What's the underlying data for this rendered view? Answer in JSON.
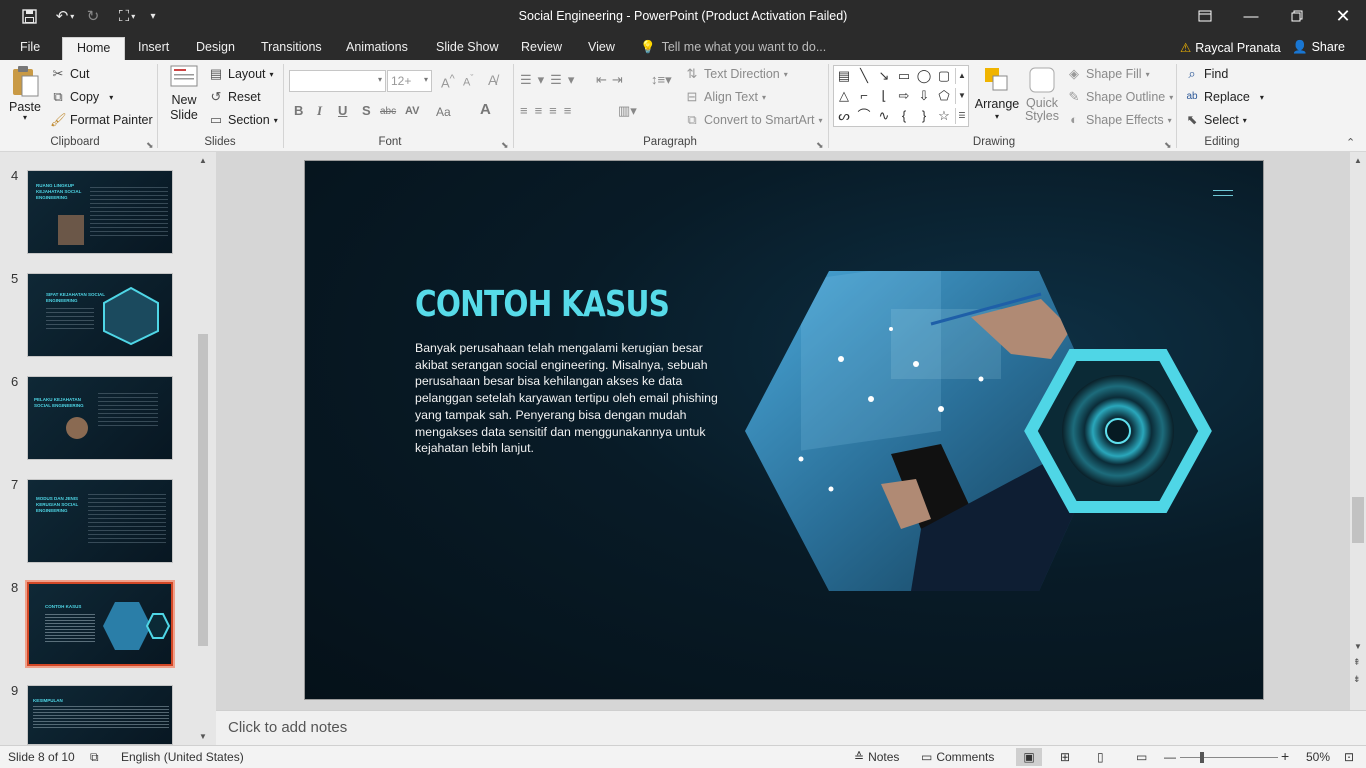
{
  "app": {
    "window_title": "Social Engineering - PowerPoint (Product Activation Failed)",
    "window_controls": {
      "ribbon_display_icon": "ribbon-display-icon",
      "minimize_icon": "minimize-icon",
      "restore_icon": "restore-icon",
      "close_icon": "close-icon"
    }
  },
  "qat": {
    "save_icon": "save-icon",
    "undo_icon": "undo-icon",
    "redo_icon": "redo-icon",
    "present_icon": "present-icon",
    "customize_icon": "chevron-down-icon"
  },
  "tabs": [
    "File",
    "Home",
    "Insert",
    "Design",
    "Transitions",
    "Animations",
    "Slide Show",
    "Review",
    "View"
  ],
  "active_tab": "Home",
  "tell_me": "Tell me what you want to do...",
  "user": {
    "name": "Raycal Pranata",
    "warning_icon": "warning-icon"
  },
  "share": "Share",
  "ribbon": {
    "clipboard": {
      "paste": "Paste",
      "cut": "Cut",
      "copy": "Copy",
      "format_painter": "Format Painter",
      "label": "Clipboard"
    },
    "slides": {
      "new_slide_1": "New",
      "new_slide_2": "Slide",
      "layout": "Layout",
      "reset": "Reset",
      "section": "Section",
      "label": "Slides"
    },
    "font": {
      "font_name": "",
      "font_size": "12+",
      "label": "Font",
      "buttons": [
        "B",
        "I",
        "U",
        "S",
        "abc",
        "AV",
        "Aa",
        "A"
      ]
    },
    "paragraph": {
      "text_direction": "Text Direction",
      "align_text": "Align Text",
      "convert_smartart": "Convert to SmartArt",
      "label": "Paragraph"
    },
    "drawing": {
      "arrange": "Arrange",
      "quick_styles_1": "Quick",
      "quick_styles_2": "Styles",
      "shape_fill": "Shape Fill",
      "shape_outline": "Shape Outline",
      "shape_effects": "Shape Effects",
      "label": "Drawing"
    },
    "editing": {
      "find": "Find",
      "replace": "Replace",
      "select": "Select",
      "label": "Editing"
    }
  },
  "thumbnails": [
    {
      "number": "4",
      "title": "RUANG LINGKUP KEJAHATAN SOCIAL ENGINEERING"
    },
    {
      "number": "5",
      "title": "SIFAT KEJAHATAN SOCIAL ENGINEERING"
    },
    {
      "number": "6",
      "title": "PELAKU KEJAHATAN SOCIAL ENGINEERING"
    },
    {
      "number": "7",
      "title": "MODUS DAN JENIS KERUGIAN SOCIAL ENGINEERING"
    },
    {
      "number": "8",
      "title": "CONTOH KASUS"
    },
    {
      "number": "9",
      "title": "KESIMPULAN"
    }
  ],
  "selected_slide": "8",
  "slide": {
    "title": "CONTOH KASUS",
    "body": "Banyak perusahaan telah mengalami kerugian besar akibat serangan social engineering. Misalnya, sebuah perusahaan besar bisa kehilangan akses ke data pelanggan setelah karyawan tertipu oleh email phishing yang tampak sah. Penyerang bisa dengan mudah mengakses data sensitif dan menggunakannya untuk kejahatan lebih lanjut.",
    "colors": {
      "title": "#57dbe9",
      "background": "#081b27",
      "accent": "#4fd6e6"
    }
  },
  "notes_placeholder": "Click to add notes",
  "status": {
    "slide_info": "Slide 8 of 10",
    "language": "English (United States)",
    "notes": "Notes",
    "comments": "Comments",
    "zoom": "50%"
  }
}
